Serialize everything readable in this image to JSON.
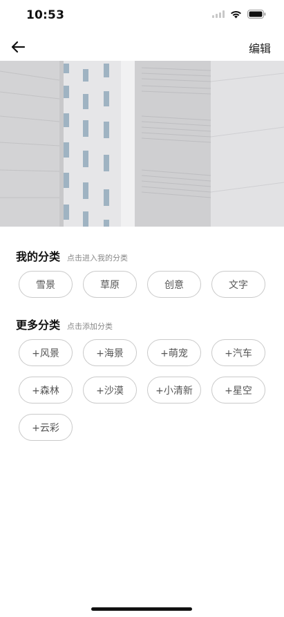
{
  "status_bar": {
    "time": "10:53",
    "icons": [
      "signal-icon",
      "wifi-icon",
      "battery-icon"
    ]
  },
  "nav": {
    "back_icon": "arrow-left-icon",
    "edit_label": "编辑"
  },
  "banner": {
    "image": "white-building-facade-photo"
  },
  "my_categories": {
    "title": "我的分类",
    "hint": "点击进入我的分类",
    "tags": [
      "雪景",
      "草原",
      "创意",
      "文字"
    ]
  },
  "more_categories": {
    "title": "更多分类",
    "hint": "点击添加分类",
    "tags": [
      "+风景",
      "+海景",
      "+萌宠",
      "+汽车",
      "+森林",
      "+沙漠",
      "+小清新",
      "+星空",
      "+云彩"
    ]
  }
}
